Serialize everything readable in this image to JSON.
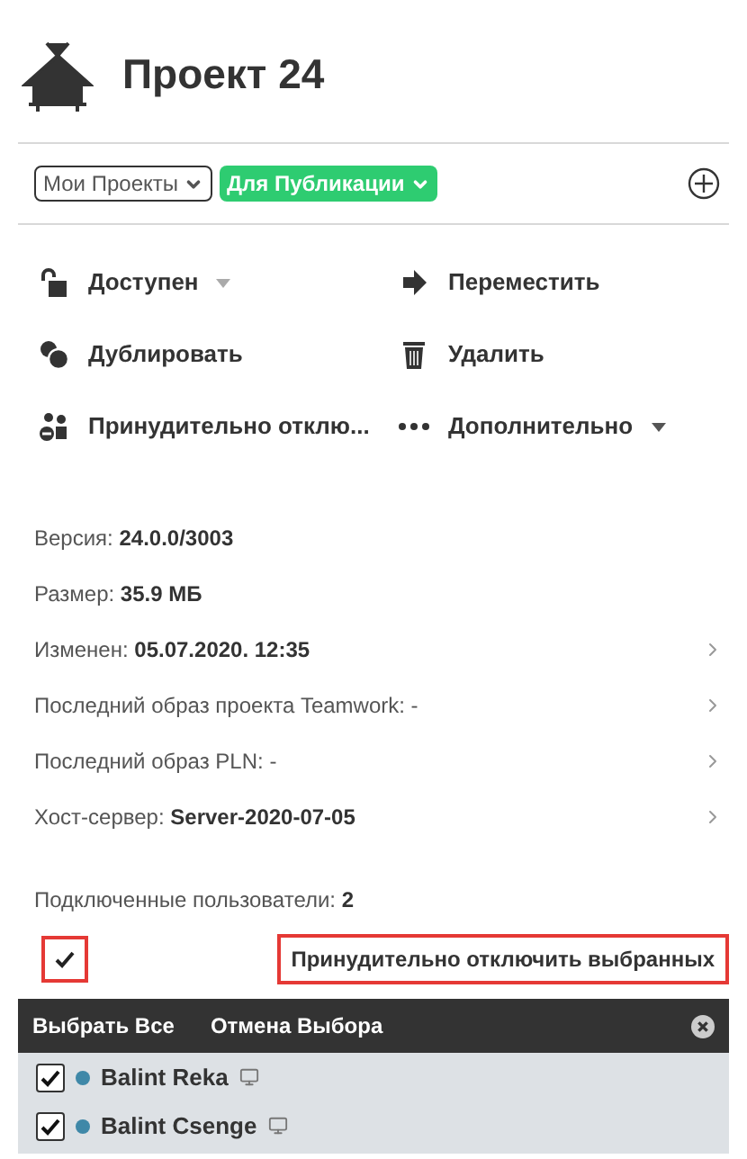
{
  "header": {
    "title": "Проект 24"
  },
  "filters": [
    {
      "label": "Мои Проекты",
      "kind": "outline"
    },
    {
      "label": "Для Публикации",
      "kind": "filled"
    }
  ],
  "actions": [
    {
      "label": "Доступен",
      "kind": "lock",
      "has_menu": true
    },
    {
      "label": "Переместить",
      "kind": "move",
      "has_menu": false
    },
    {
      "label": "Дублировать",
      "kind": "duplicate",
      "has_menu": false
    },
    {
      "label": "Удалить",
      "kind": "delete",
      "has_menu": false
    },
    {
      "label": "Принудительно отклю...",
      "kind": "disconnect",
      "has_menu": false
    },
    {
      "label": "Дополнительно",
      "kind": "more",
      "has_menu": true
    }
  ],
  "info": [
    {
      "label": "Версия:",
      "value": "24.0.0/3003",
      "link": false
    },
    {
      "label": "Размер:",
      "value": "35.9 МБ",
      "link": false
    },
    {
      "label": "Изменен:",
      "value": "05.07.2020. 12:35",
      "link": true
    },
    {
      "label": "Последний образ проекта Teamwork: -",
      "link": true
    },
    {
      "label": "Последний образ PLN: -",
      "link": true
    },
    {
      "label": "Хост-сервер:",
      "value": "Server-2020-07-05",
      "link": true
    }
  ],
  "connected_users": {
    "label": "Подключенные пользователи:",
    "count": "2"
  },
  "select_toggle": {
    "checked": true
  },
  "disconnect_button": "Принудительно отключить выбранных",
  "toolbar": {
    "select_all": "Выбрать Все",
    "deselect": "Отмена Выбора"
  },
  "users": [
    {
      "name": "Balint Reka",
      "checked": true,
      "color": "#3f88a8"
    },
    {
      "name": "Balint Csenge",
      "checked": true,
      "color": "#3f88a8"
    }
  ]
}
